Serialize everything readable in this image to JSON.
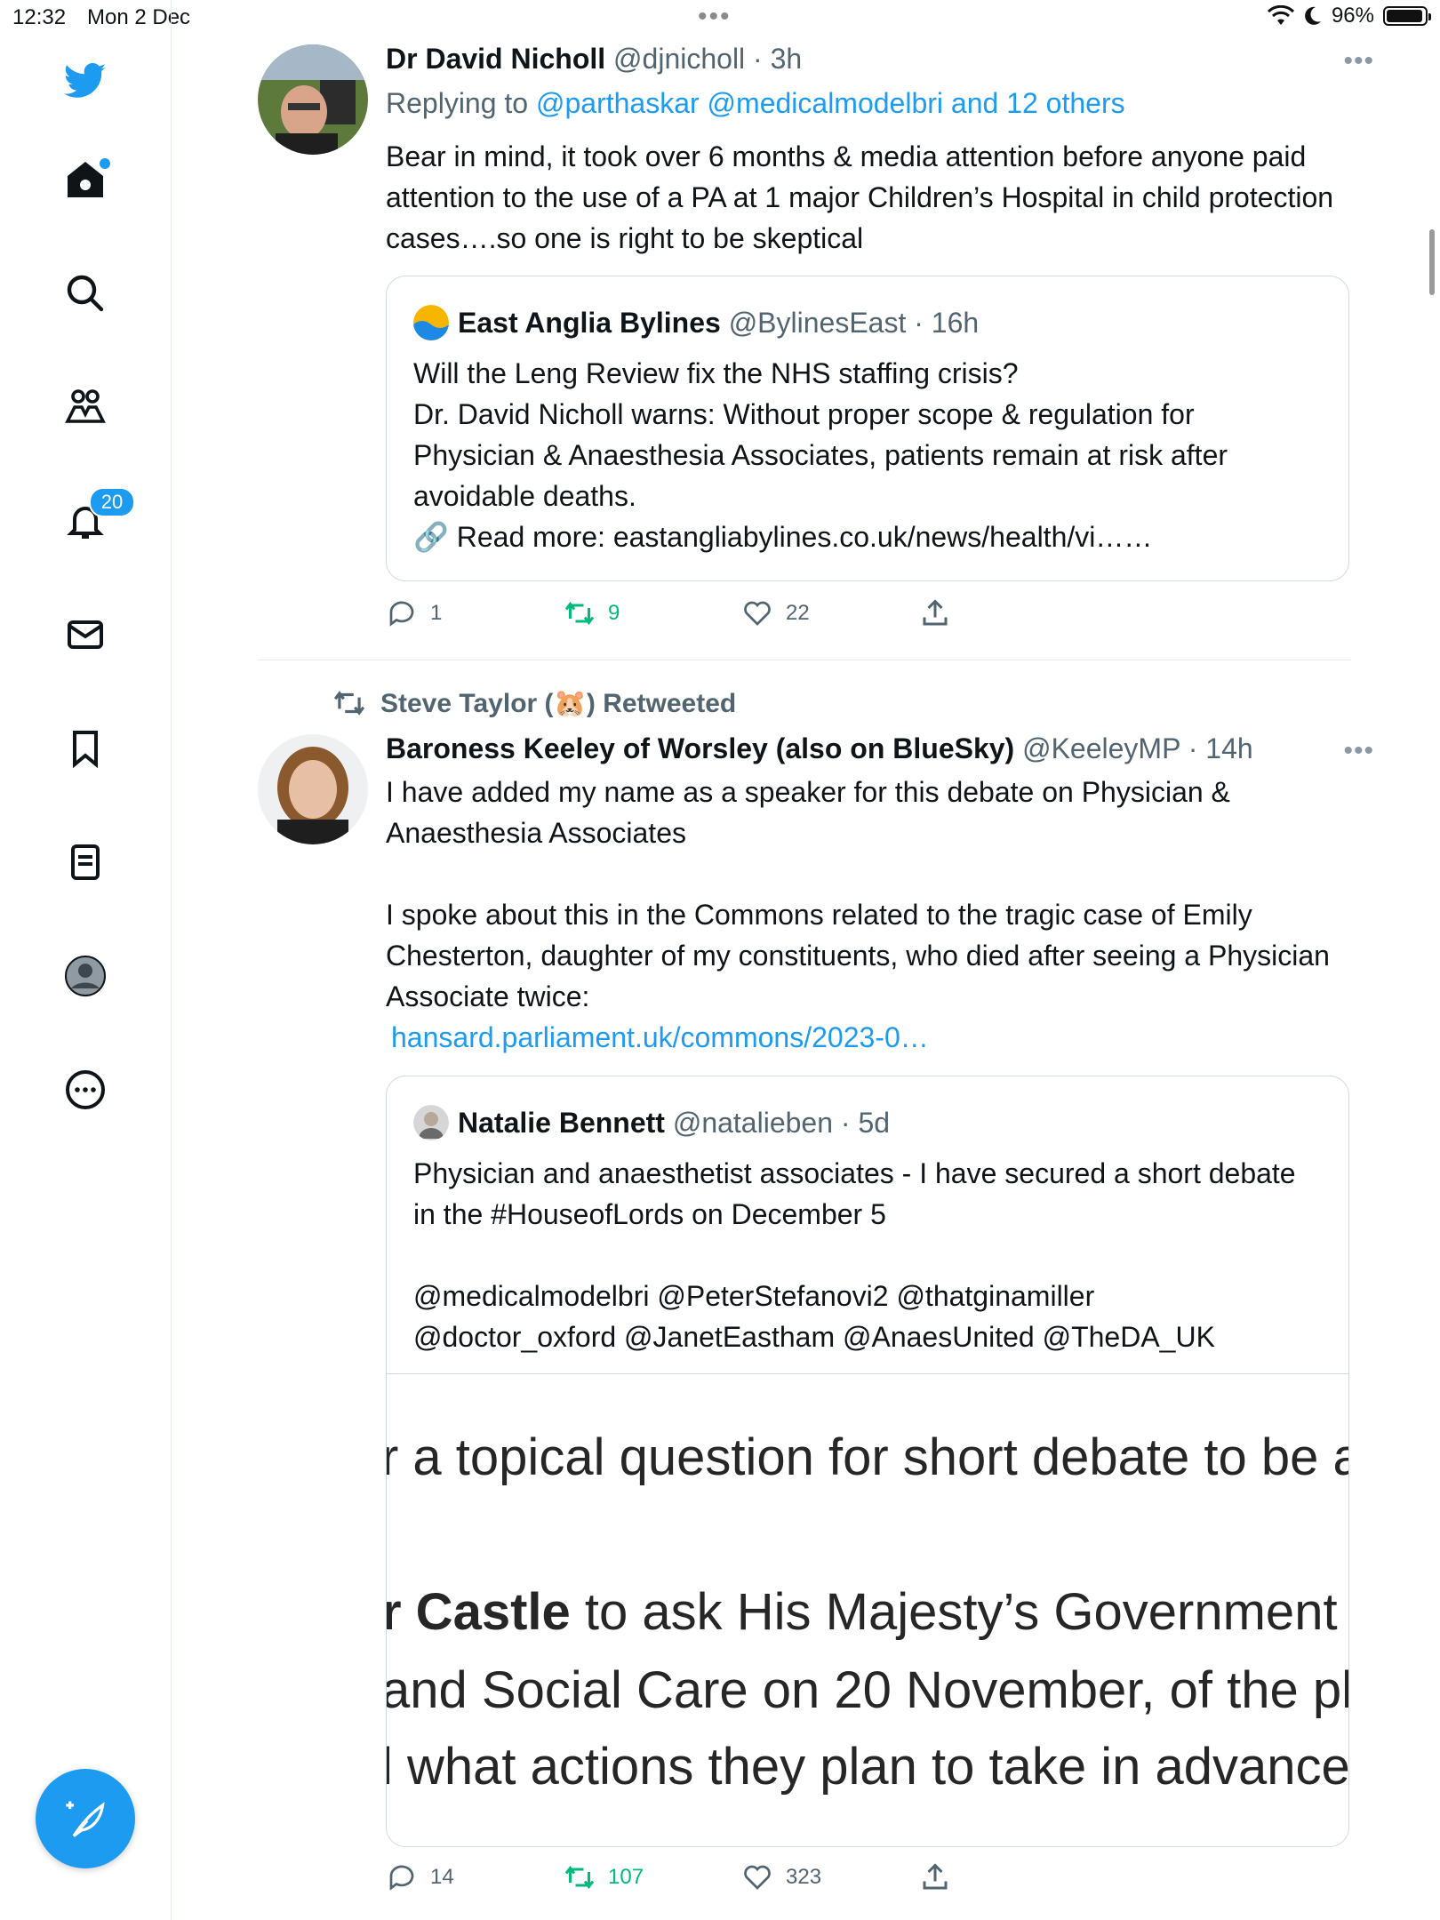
{
  "status": {
    "time": "12:32",
    "date": "Mon 2 Dec",
    "dots": "•••",
    "battery_percent": "96%",
    "battery_level": 0.96
  },
  "sidebar": {
    "notifications_badge": "20",
    "compose_label": "+"
  },
  "tweets": [
    {
      "name": "Dr David Nicholl",
      "handle": "@djnicholl",
      "time": "· 3h",
      "more": "•••",
      "replying_prefix": "Replying to",
      "replying_to": "@parthaskar @medicalmodelbri and 12 others",
      "text": "Bear in mind, it took over 6 months & media attention before anyone paid attention to the use of a PA at 1 major Children’s Hospital in child protection cases….so one is right to be skeptical",
      "quote": {
        "name": "East Anglia Bylines",
        "handle": "@BylinesEast",
        "time": "· 16h",
        "lines": [
          "Will the Leng Review fix the NHS staffing crisis?",
          "Dr. David Nicholl warns: Without proper scope & regulation for Physician & Anaesthesia Associates, patients remain at risk after avoidable deaths.",
          "🔗 Read more: eastangliabylines.co.uk/news/health/vi……"
        ]
      },
      "replies": "1",
      "retweets": "9",
      "likes": "22"
    },
    {
      "retweeted_by": "Steve Taylor (🐹) Retweeted",
      "name": "Baroness Keeley of Worsley (also on BlueSky)",
      "handle": "@KeeleyMP",
      "time": "· 14h",
      "more": "•••",
      "paragraph1": "I have added my name as a speaker for this debate on Physician & Anaesthesia Associates",
      "paragraph2": "I spoke about this in the Commons related to the tragic case of Emily Chesterton, daughter of my constituents, who died after seeing a Physician Associate twice:",
      "link": "hansard.parliament.uk/commons/2023-0…",
      "quote": {
        "name": "Natalie Bennett",
        "handle": "@natalieben",
        "time": "· 5d",
        "line1": "Physician and anaesthetist associates - I have secured a short debate in the #HouseofLords on December 5",
        "line2": "@medicalmodelbri @PeterStefanovi2 @thatginamiller @doctor_oxford @JanetEastham @AnaesUnited @TheDA_UK",
        "image_lines": [
          {
            "bold": "",
            "text": "r a topical question for short debate to be a"
          },
          {
            "bold": "r Castle",
            "text": " to ask His Majesty’s Government"
          },
          {
            "bold": "",
            "text": "and Social Care on 20 November, of the pl"
          },
          {
            "bold": "",
            "text": "l what actions they plan to take in advance"
          }
        ]
      },
      "replies": "14",
      "retweets": "107",
      "likes": "323"
    }
  ],
  "colors": {
    "accent": "#1d9bf0",
    "retweet_green": "#00ba7c",
    "text": "#0f1419",
    "muted": "#536471"
  }
}
